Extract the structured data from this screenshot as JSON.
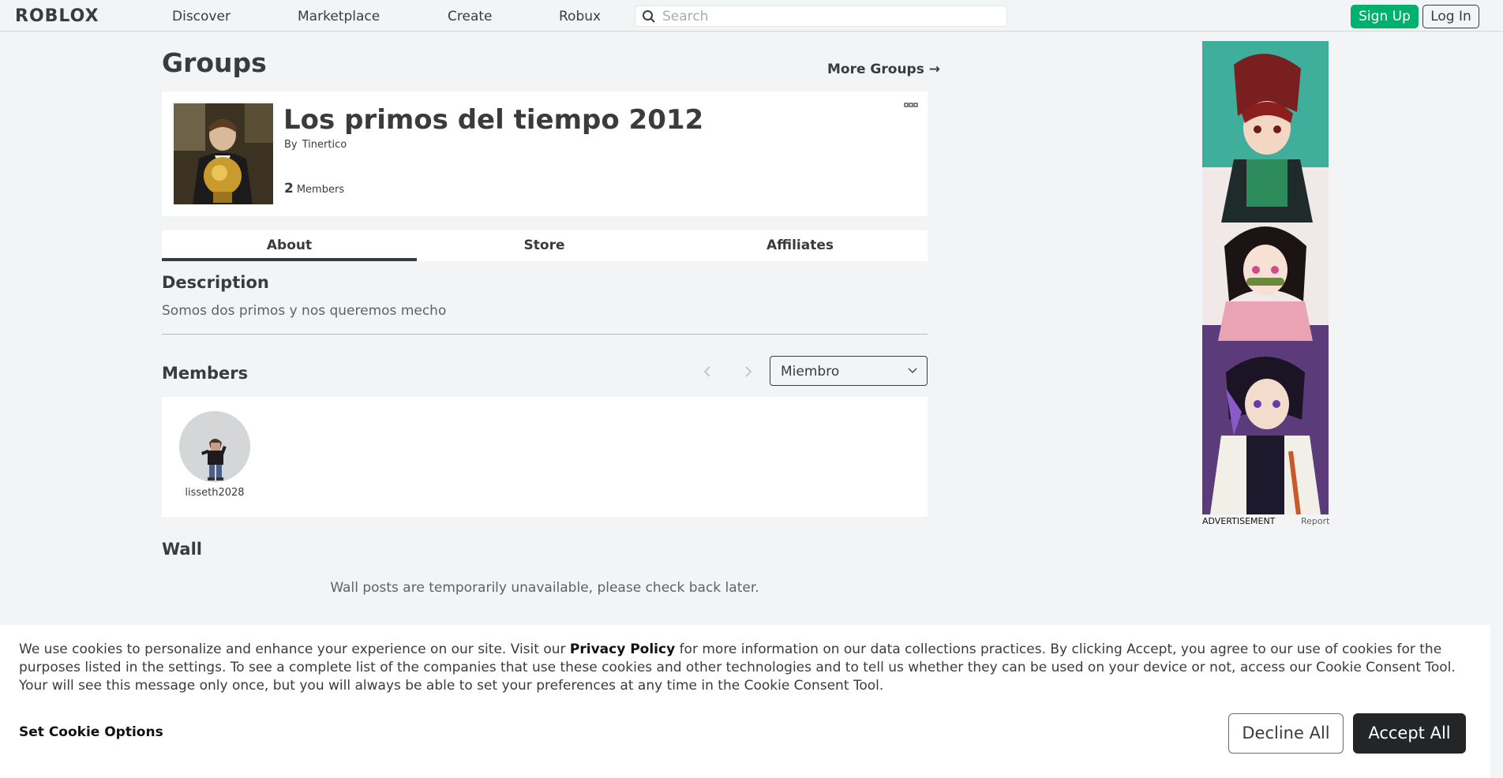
{
  "header": {
    "logo": "ROBLOX",
    "nav": [
      "Discover",
      "Marketplace",
      "Create",
      "Robux"
    ],
    "search_placeholder": "Search",
    "signup_label": "Sign Up",
    "login_label": "Log In"
  },
  "page": {
    "title": "Groups",
    "more_groups": "More Groups →"
  },
  "group": {
    "name": "Los primos del tiempo 2012",
    "by_label": "By",
    "owner": "Tinertico",
    "member_count": "2",
    "members_label": "Members"
  },
  "tabs": [
    "About",
    "Store",
    "Affiliates"
  ],
  "description": {
    "title": "Description",
    "text": "Somos dos primos y nos queremos mecho"
  },
  "members": {
    "title": "Members",
    "role_selected": "Miembro",
    "list": [
      {
        "username": "lisseth2028"
      }
    ]
  },
  "wall": {
    "title": "Wall",
    "message": "Wall posts are temporarily unavailable, please check back later."
  },
  "ad": {
    "label": "ADVERTISEMENT",
    "report": "Report"
  },
  "cookie": {
    "text_before": "We use cookies to personalize and enhance your experience on our site. Visit our ",
    "link": "Privacy Policy",
    "text_after": " for more information on our data collections practices. By clicking Accept, you agree to our use of cookies for the purposes listed in the settings. To see a complete list of the companies that use these cookies and other technologies and to tell us whether they can be used on your device or not, access our Cookie Consent Tool. Your will see this message only once, but you will always be able to set your preferences at any time in the Cookie Consent Tool.",
    "options": "Set Cookie Options",
    "decline": "Decline All",
    "accept": "Accept All"
  },
  "colors": {
    "accent_green": "#00b06f",
    "text": "#393b3d",
    "background": "#f2f4f5"
  }
}
